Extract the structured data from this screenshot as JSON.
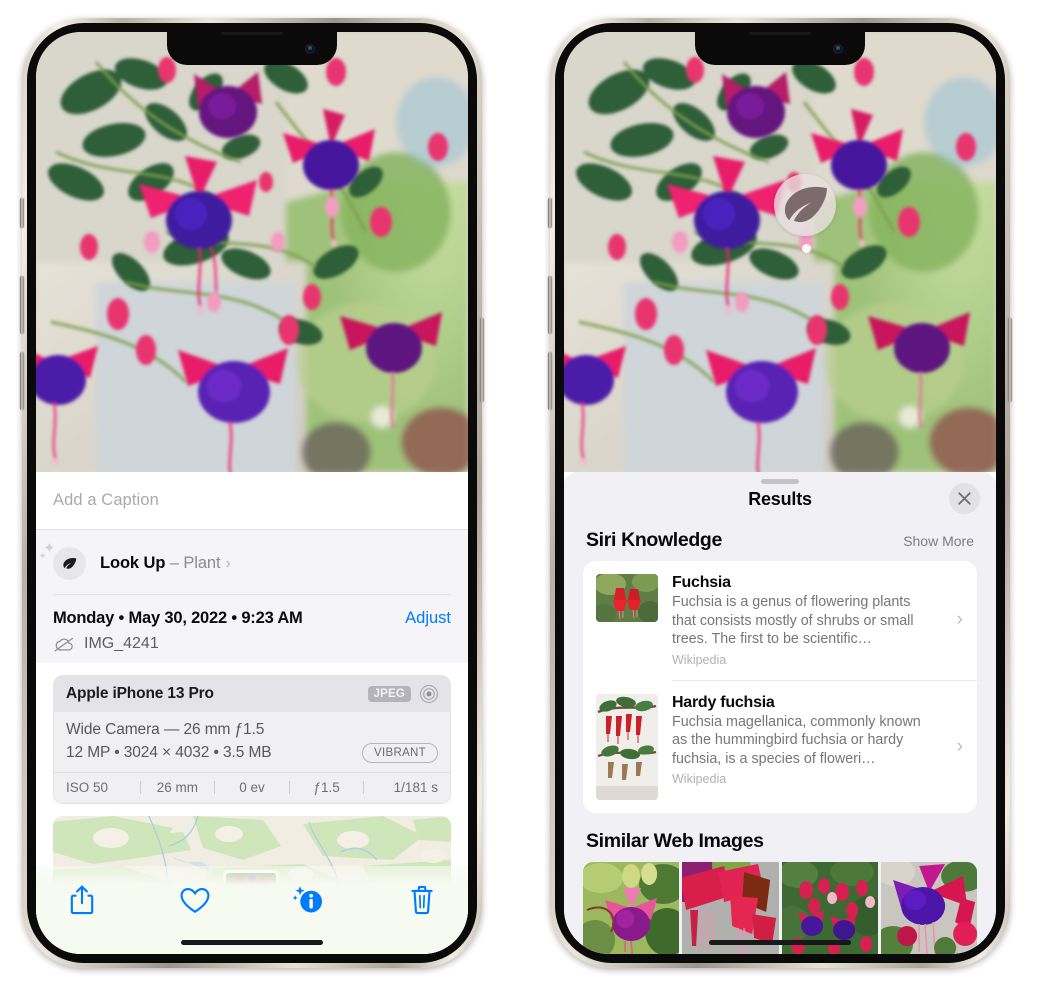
{
  "left_phone": {
    "caption": {
      "placeholder": "Add a Caption",
      "value": ""
    },
    "look_up": {
      "label": "Look Up",
      "dash": " – ",
      "subject": "Plant",
      "chevron": "›",
      "icon": "leaf-icon"
    },
    "meta": {
      "date": "Monday • May 30, 2022 • 9:23 AM",
      "adjust_label": "Adjust",
      "filename": "IMG_4241",
      "cloud_icon": "icloud-slash-icon"
    },
    "camera_card": {
      "model": "Apple iPhone 13 Pro",
      "format_badge": "JPEG",
      "hdr_icon": "hdr-target-icon",
      "lens": "Wide Camera — 26 mm ƒ1.5",
      "size": "12 MP • 3024 × 4032 • 3.5 MB",
      "style_badge": "VIBRANT",
      "exif": [
        "ISO 50",
        "26 mm",
        "0 ev",
        "ƒ1.5",
        "1/181 s"
      ]
    },
    "toolbar": {
      "share_label": "share-icon",
      "favorite_label": "heart-icon",
      "info_label": "info-sparkle-icon",
      "delete_label": "trash-icon"
    },
    "accent_color": "#007AFF"
  },
  "right_phone": {
    "visual_lookup_badge": {
      "icon": "leaf-icon"
    },
    "results": {
      "title": "Results",
      "close_label": "✕",
      "sections": [
        {
          "title": "Siri Knowledge",
          "action": "Show More",
          "items": [
            {
              "title": "Fuchsia",
              "description": "Fuchsia is a genus of flowering plants that consists mostly of shrubs or small trees. The first to be scientific…",
              "source": "Wikipedia",
              "chevron": "›"
            },
            {
              "title": "Hardy fuchsia",
              "description": "Fuchsia magellanica, commonly known as the hummingbird fuchsia or hardy fuchsia, is a species of floweri…",
              "source": "Wikipedia",
              "chevron": "›"
            }
          ]
        },
        {
          "title": "Similar Web Images",
          "action": "",
          "thumbnails": [
            "web-image-1",
            "web-image-2",
            "web-image-3",
            "web-image-4"
          ]
        }
      ]
    }
  }
}
